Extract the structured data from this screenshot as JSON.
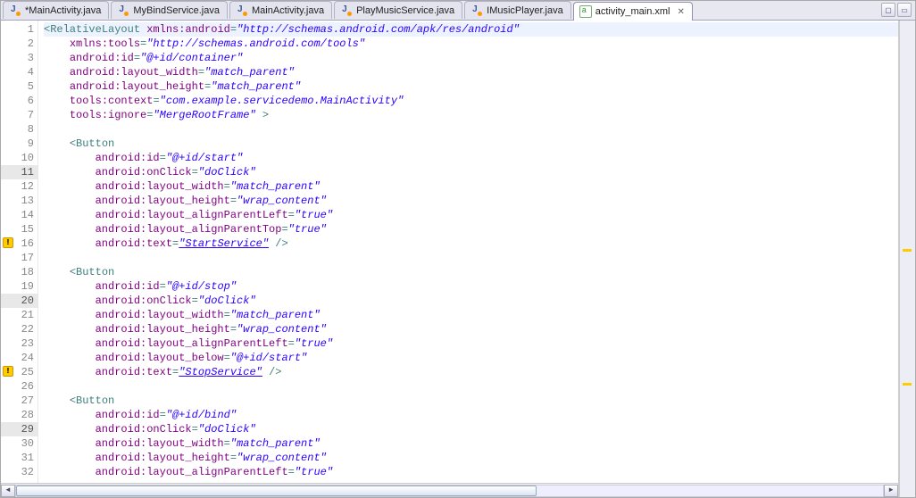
{
  "tabs": [
    {
      "label": "*MainActivity.java",
      "type": "java",
      "active": false
    },
    {
      "label": "MyBindService.java",
      "type": "java",
      "active": false
    },
    {
      "label": "MainActivity.java",
      "type": "java",
      "active": false
    },
    {
      "label": "PlayMusicService.java",
      "type": "java",
      "active": false
    },
    {
      "label": "IMusicPlayer.java",
      "type": "java",
      "active": false
    },
    {
      "label": "activity_main.xml",
      "type": "xml",
      "active": true
    }
  ],
  "lines": [
    {
      "n": 1,
      "warn": false,
      "hl": true,
      "tokens": [
        [
          "sym",
          "<"
        ],
        [
          "tag",
          "RelativeLayout"
        ],
        [
          "",
          ""
        ],
        [
          "",
          " "
        ],
        [
          "attr",
          "xmlns:android"
        ],
        [
          "sym",
          "="
        ],
        [
          "str",
          "\"http://schemas.android.com/apk/res/android\""
        ]
      ]
    },
    {
      "n": 2,
      "warn": false,
      "hl": false,
      "tokens": [
        [
          "",
          "    "
        ],
        [
          "attr",
          "xmlns:tools"
        ],
        [
          "sym",
          "="
        ],
        [
          "str",
          "\"http://schemas.android.com/tools\""
        ]
      ]
    },
    {
      "n": 3,
      "warn": false,
      "hl": false,
      "tokens": [
        [
          "",
          "    "
        ],
        [
          "attr",
          "android:id"
        ],
        [
          "sym",
          "="
        ],
        [
          "str",
          "\"@+id/container\""
        ]
      ]
    },
    {
      "n": 4,
      "warn": false,
      "hl": false,
      "tokens": [
        [
          "",
          "    "
        ],
        [
          "attr",
          "android:layout_width"
        ],
        [
          "sym",
          "="
        ],
        [
          "str",
          "\"match_parent\""
        ]
      ]
    },
    {
      "n": 5,
      "warn": false,
      "hl": false,
      "tokens": [
        [
          "",
          "    "
        ],
        [
          "attr",
          "android:layout_height"
        ],
        [
          "sym",
          "="
        ],
        [
          "str",
          "\"match_parent\""
        ]
      ]
    },
    {
      "n": 6,
      "warn": false,
      "hl": false,
      "tokens": [
        [
          "",
          "    "
        ],
        [
          "attr",
          "tools:context"
        ],
        [
          "sym",
          "="
        ],
        [
          "str",
          "\"com.example.servicedemo.MainActivity\""
        ]
      ]
    },
    {
      "n": 7,
      "warn": false,
      "hl": false,
      "tokens": [
        [
          "",
          "    "
        ],
        [
          "attr",
          "tools:ignore"
        ],
        [
          "sym",
          "="
        ],
        [
          "str",
          "\"MergeRootFrame\""
        ],
        [
          "",
          " "
        ],
        [
          "sym",
          ">"
        ]
      ]
    },
    {
      "n": 8,
      "warn": false,
      "hl": false,
      "tokens": [
        [
          "",
          ""
        ]
      ]
    },
    {
      "n": 9,
      "warn": false,
      "hl": false,
      "tokens": [
        [
          "",
          "    "
        ],
        [
          "sym",
          "<"
        ],
        [
          "tag",
          "Button"
        ]
      ]
    },
    {
      "n": 10,
      "warn": false,
      "hl": false,
      "tokens": [
        [
          "",
          "        "
        ],
        [
          "attr",
          "android:id"
        ],
        [
          "sym",
          "="
        ],
        [
          "str",
          "\"@+id/start\""
        ]
      ]
    },
    {
      "n": 11,
      "warn": false,
      "hl": false,
      "hlnum": true,
      "tokens": [
        [
          "",
          "        "
        ],
        [
          "attr",
          "android:onClick"
        ],
        [
          "sym",
          "="
        ],
        [
          "str",
          "\"doClick\""
        ]
      ]
    },
    {
      "n": 12,
      "warn": false,
      "hl": false,
      "tokens": [
        [
          "",
          "        "
        ],
        [
          "attr",
          "android:layout_width"
        ],
        [
          "sym",
          "="
        ],
        [
          "str",
          "\"match_parent\""
        ]
      ]
    },
    {
      "n": 13,
      "warn": false,
      "hl": false,
      "tokens": [
        [
          "",
          "        "
        ],
        [
          "attr",
          "android:layout_height"
        ],
        [
          "sym",
          "="
        ],
        [
          "str",
          "\"wrap_content\""
        ]
      ]
    },
    {
      "n": 14,
      "warn": false,
      "hl": false,
      "tokens": [
        [
          "",
          "        "
        ],
        [
          "attr",
          "android:layout_alignParentLeft"
        ],
        [
          "sym",
          "="
        ],
        [
          "str",
          "\"true\""
        ]
      ]
    },
    {
      "n": 15,
      "warn": false,
      "hl": false,
      "tokens": [
        [
          "",
          "        "
        ],
        [
          "attr",
          "android:layout_alignParentTop"
        ],
        [
          "sym",
          "="
        ],
        [
          "str",
          "\"true\""
        ]
      ]
    },
    {
      "n": 16,
      "warn": true,
      "hl": false,
      "tokens": [
        [
          "",
          "        "
        ],
        [
          "attr",
          "android:text"
        ],
        [
          "sym",
          "="
        ],
        [
          "stru",
          "\"StartService\""
        ],
        [
          "",
          " "
        ],
        [
          "sym",
          "/>"
        ]
      ]
    },
    {
      "n": 17,
      "warn": false,
      "hl": false,
      "tokens": [
        [
          "",
          ""
        ]
      ]
    },
    {
      "n": 18,
      "warn": false,
      "hl": false,
      "tokens": [
        [
          "",
          "    "
        ],
        [
          "sym",
          "<"
        ],
        [
          "tag",
          "Button"
        ]
      ]
    },
    {
      "n": 19,
      "warn": false,
      "hl": false,
      "tokens": [
        [
          "",
          "        "
        ],
        [
          "attr",
          "android:id"
        ],
        [
          "sym",
          "="
        ],
        [
          "str",
          "\"@+id/stop\""
        ]
      ]
    },
    {
      "n": 20,
      "warn": false,
      "hl": false,
      "hlnum": true,
      "tokens": [
        [
          "",
          "        "
        ],
        [
          "attr",
          "android:onClick"
        ],
        [
          "sym",
          "="
        ],
        [
          "str",
          "\"doClick\""
        ]
      ]
    },
    {
      "n": 21,
      "warn": false,
      "hl": false,
      "tokens": [
        [
          "",
          "        "
        ],
        [
          "attr",
          "android:layout_width"
        ],
        [
          "sym",
          "="
        ],
        [
          "str",
          "\"match_parent\""
        ]
      ]
    },
    {
      "n": 22,
      "warn": false,
      "hl": false,
      "tokens": [
        [
          "",
          "        "
        ],
        [
          "attr",
          "android:layout_height"
        ],
        [
          "sym",
          "="
        ],
        [
          "str",
          "\"wrap_content\""
        ]
      ]
    },
    {
      "n": 23,
      "warn": false,
      "hl": false,
      "tokens": [
        [
          "",
          "        "
        ],
        [
          "attr",
          "android:layout_alignParentLeft"
        ],
        [
          "sym",
          "="
        ],
        [
          "str",
          "\"true\""
        ]
      ]
    },
    {
      "n": 24,
      "warn": false,
      "hl": false,
      "tokens": [
        [
          "",
          "        "
        ],
        [
          "attr",
          "android:layout_below"
        ],
        [
          "sym",
          "="
        ],
        [
          "str",
          "\"@+id/start\""
        ]
      ]
    },
    {
      "n": 25,
      "warn": true,
      "hl": false,
      "tokens": [
        [
          "",
          "        "
        ],
        [
          "attr",
          "android:text"
        ],
        [
          "sym",
          "="
        ],
        [
          "stru",
          "\"StopService\""
        ],
        [
          "",
          " "
        ],
        [
          "sym",
          "/>"
        ]
      ]
    },
    {
      "n": 26,
      "warn": false,
      "hl": false,
      "tokens": [
        [
          "",
          ""
        ]
      ]
    },
    {
      "n": 27,
      "warn": false,
      "hl": false,
      "tokens": [
        [
          "",
          "    "
        ],
        [
          "sym",
          "<"
        ],
        [
          "tag",
          "Button"
        ]
      ]
    },
    {
      "n": 28,
      "warn": false,
      "hl": false,
      "tokens": [
        [
          "",
          "        "
        ],
        [
          "attr",
          "android:id"
        ],
        [
          "sym",
          "="
        ],
        [
          "str",
          "\"@+id/bind\""
        ]
      ]
    },
    {
      "n": 29,
      "warn": false,
      "hl": false,
      "hlnum": true,
      "tokens": [
        [
          "",
          "        "
        ],
        [
          "attr",
          "android:onClick"
        ],
        [
          "sym",
          "="
        ],
        [
          "str",
          "\"doClick\""
        ]
      ]
    },
    {
      "n": 30,
      "warn": false,
      "hl": false,
      "tokens": [
        [
          "",
          "        "
        ],
        [
          "attr",
          "android:layout_width"
        ],
        [
          "sym",
          "="
        ],
        [
          "str",
          "\"match_parent\""
        ]
      ]
    },
    {
      "n": 31,
      "warn": false,
      "hl": false,
      "tokens": [
        [
          "",
          "        "
        ],
        [
          "attr",
          "android:layout_height"
        ],
        [
          "sym",
          "="
        ],
        [
          "str",
          "\"wrap_content\""
        ]
      ]
    },
    {
      "n": 32,
      "warn": false,
      "hl": false,
      "tokens": [
        [
          "",
          "        "
        ],
        [
          "attr",
          "android:layout_alignParentLeft"
        ],
        [
          "sym",
          "="
        ],
        [
          "str",
          "\"true\""
        ]
      ]
    }
  ],
  "overview_marks": [
    0.48,
    0.76
  ]
}
